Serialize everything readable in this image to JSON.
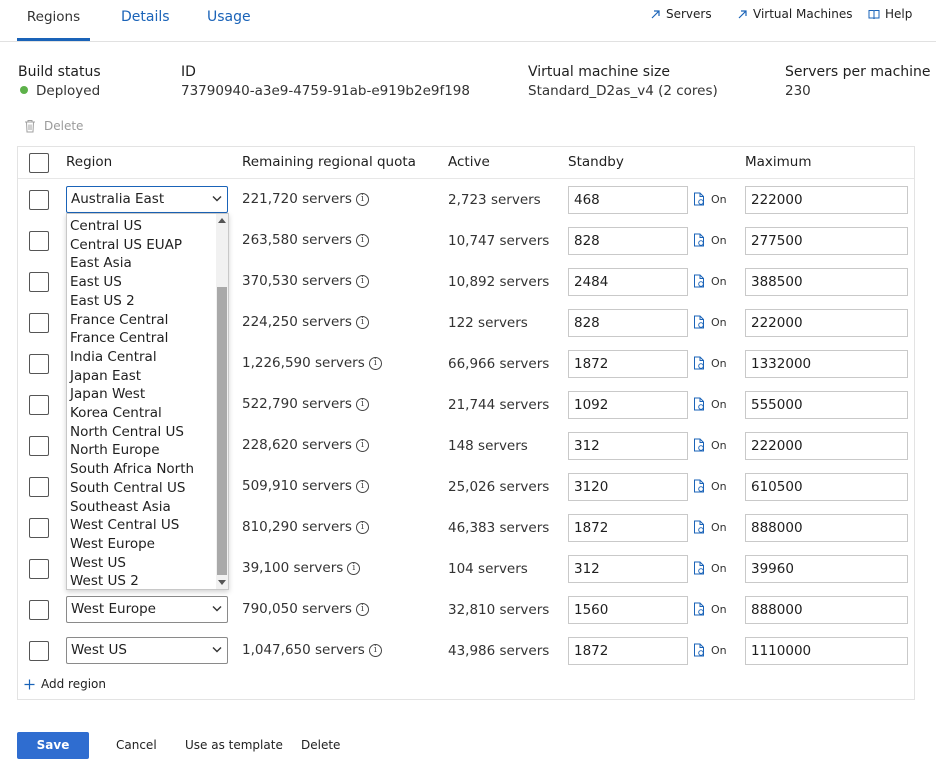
{
  "tabs": [
    {
      "label": "Regions",
      "active": true
    },
    {
      "label": "Details",
      "active": false
    },
    {
      "label": "Usage",
      "active": false
    }
  ],
  "top_links": {
    "servers": "Servers",
    "virtual_machines": "Virtual Machines",
    "help": "Help"
  },
  "info": {
    "build_status_label": "Build status",
    "build_status_value": "Deployed",
    "id_label": "ID",
    "id_value": "73790940-a3e9-4759-91ab-e919b2e9f198",
    "vm_size_label": "Virtual machine size",
    "vm_size_value": "Standard_D2as_v4 (2 cores)",
    "servers_per_machine_label": "Servers per machine",
    "servers_per_machine_value": "230"
  },
  "toolbar": {
    "delete_label": "Delete"
  },
  "table": {
    "headers": {
      "region": "Region",
      "quota": "Remaining regional quota",
      "active": "Active",
      "standby": "Standby",
      "maximum": "Maximum"
    },
    "rows": [
      {
        "region": "Australia East",
        "quota": "221,720 servers",
        "active": "2,723 servers",
        "standby": "468",
        "toggle": "On",
        "maximum": "222000"
      },
      {
        "region": "",
        "quota": "263,580 servers",
        "active": "10,747 servers",
        "standby": "828",
        "toggle": "On",
        "maximum": "277500"
      },
      {
        "region": "",
        "quota": "370,530 servers",
        "active": "10,892 servers",
        "standby": "2484",
        "toggle": "On",
        "maximum": "388500"
      },
      {
        "region": "",
        "quota": "224,250 servers",
        "active": "122 servers",
        "standby": "828",
        "toggle": "On",
        "maximum": "222000"
      },
      {
        "region": "",
        "quota": "1,226,590 servers",
        "active": "66,966 servers",
        "standby": "1872",
        "toggle": "On",
        "maximum": "1332000"
      },
      {
        "region": "",
        "quota": "522,790 servers",
        "active": "21,744 servers",
        "standby": "1092",
        "toggle": "On",
        "maximum": "555000"
      },
      {
        "region": "",
        "quota": "228,620 servers",
        "active": "148 servers",
        "standby": "312",
        "toggle": "On",
        "maximum": "222000"
      },
      {
        "region": "",
        "quota": "509,910 servers",
        "active": "25,026 servers",
        "standby": "3120",
        "toggle": "On",
        "maximum": "610500"
      },
      {
        "region": "",
        "quota": "810,290 servers",
        "active": "46,383 servers",
        "standby": "1872",
        "toggle": "On",
        "maximum": "888000"
      },
      {
        "region": "",
        "quota": "39,100 servers",
        "active": "104 servers",
        "standby": "312",
        "toggle": "On",
        "maximum": "39960"
      },
      {
        "region": "West Europe",
        "quota": "790,050 servers",
        "active": "32,810 servers",
        "standby": "1560",
        "toggle": "On",
        "maximum": "888000"
      },
      {
        "region": "West US",
        "quota": "1,047,650 servers",
        "active": "43,986 servers",
        "standby": "1872",
        "toggle": "On",
        "maximum": "1110000"
      }
    ]
  },
  "dropdown": {
    "options": [
      "Central US",
      "Central US EUAP",
      "East Asia",
      "East US",
      "East US 2",
      "France Central",
      "France Central",
      "India Central",
      "Japan East",
      "Japan West",
      "Korea Central",
      "North Central US",
      "North Europe",
      "South Africa North",
      "South Central US",
      "Southeast Asia",
      "West Central US",
      "West Europe",
      "West US",
      "West US 2"
    ]
  },
  "add_region_label": "Add region",
  "footer": {
    "save": "Save",
    "cancel": "Cancel",
    "use_as_template": "Use as template",
    "delete": "Delete"
  },
  "colors": {
    "accent": "#1a63b8",
    "primary_button": "#2f6dd0",
    "status_ok": "#5db14a"
  }
}
